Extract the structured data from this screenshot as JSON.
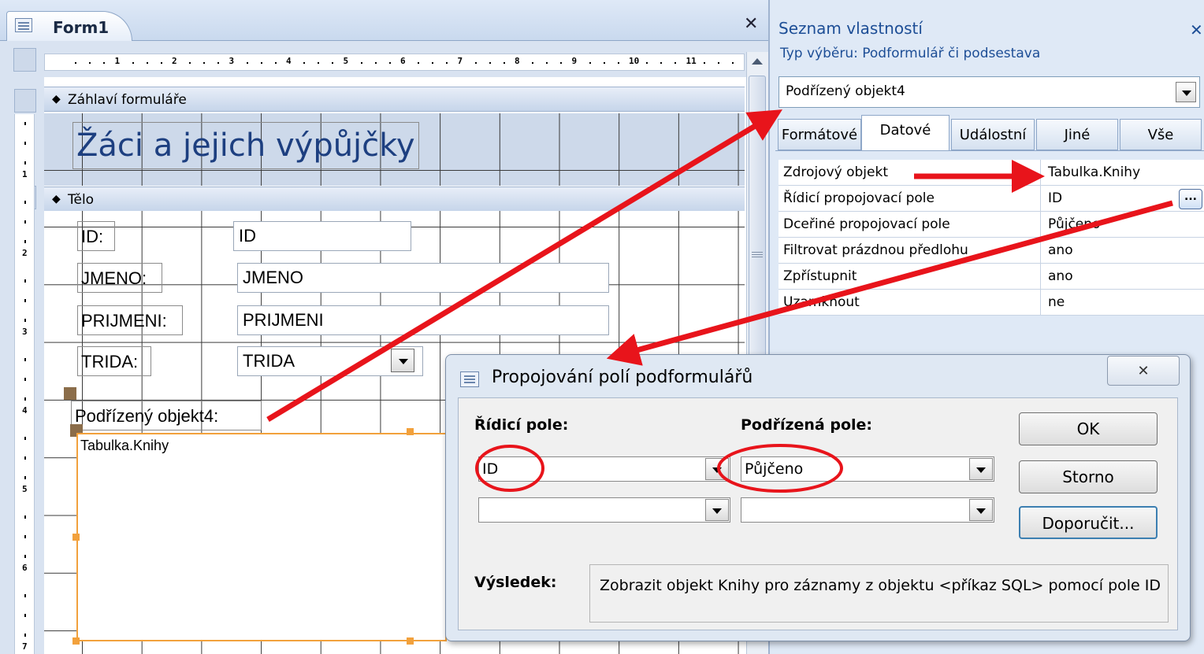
{
  "form_window": {
    "tab_title": "Form1",
    "close_glyph": "✕",
    "ruler_numbers": [
      "1",
      "2",
      "3",
      "4",
      "5",
      "6",
      "7",
      "8",
      "9",
      "10",
      "11"
    ],
    "vruler_numbers": [
      "1",
      "2",
      "3",
      "4",
      "5",
      "6",
      "7"
    ],
    "header_section": "Záhlaví formuláře",
    "body_section": "Tělo",
    "header_title": "Žáci a jejich výpůjčky",
    "fields": {
      "id_label": "ID:",
      "id_value": "ID",
      "jmeno_label": "JMENO:",
      "jmeno_value": "JMENO",
      "prijmeni_label": "PRIJMENI:",
      "prijmeni_value": "PRIJMENI",
      "trida_label": "TRIDA:",
      "trida_value": "TRIDA"
    },
    "subform_label": "Podřízený objekt4:",
    "subform_source": "Tabulka.Knihy"
  },
  "property_sheet": {
    "title": "Seznam vlastností",
    "close_glyph": "✕",
    "selection_type_label": "Typ výběru:  Podformulář či podsestava",
    "selected_object": "Podřízený objekt4",
    "tabs": [
      "Formátové",
      "Datové",
      "Událostní",
      "Jiné",
      "Vše"
    ],
    "active_tab": "Datové",
    "properties": [
      {
        "name": "Zdrojový objekt",
        "value": "Tabulka.Knihy"
      },
      {
        "name": "Řídicí propojovací pole",
        "value": "ID"
      },
      {
        "name": "Dceřiné propojovací pole",
        "value": "Půjčeno"
      },
      {
        "name": "Filtrovat prázdnou předlohu",
        "value": "ano"
      },
      {
        "name": "Zpřístupnit",
        "value": "ano"
      },
      {
        "name": "Uzamknout",
        "value": "ne"
      }
    ],
    "builder_button": "..."
  },
  "dialog": {
    "title": "Propojování polí podformulářů",
    "close_glyph": "✕",
    "master_label": "Řídicí pole:",
    "child_label": "Podřízená pole:",
    "master_values": [
      "ID",
      ""
    ],
    "child_values": [
      "Půjčeno",
      ""
    ],
    "ok_button": "OK",
    "cancel_button": "Storno",
    "suggest_button": "Doporučit...",
    "result_label": "Výsledek:",
    "result_text": "Zobrazit objekt Knihy pro záznamy z objektu <příkaz SQL> pomocí pole ID"
  },
  "annotation_color": "#e8141b"
}
